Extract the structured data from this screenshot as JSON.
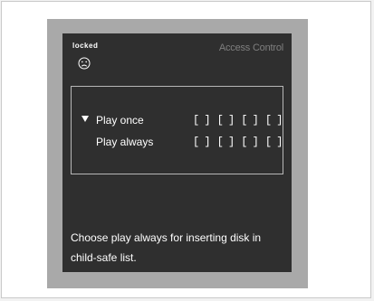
{
  "status": {
    "label": "locked",
    "icon": "sad-face-icon"
  },
  "title": "Access Control",
  "options": [
    {
      "label": "Play once",
      "selected": true,
      "slots": [
        "[ ]",
        "[ ]",
        "[ ]",
        "[ ]"
      ]
    },
    {
      "label": "Play always",
      "selected": false,
      "slots": [
        "[ ]",
        "[ ]",
        "[ ]",
        "[ ]"
      ]
    }
  ],
  "help": {
    "line1": "Choose play always for inserting disk in",
    "line2": "child-safe list."
  },
  "colors": {
    "screen_bg": "#2f2f2f",
    "frame": "#a9a9a9",
    "title_text": "#7f7f7f",
    "text": "#ffffff"
  }
}
